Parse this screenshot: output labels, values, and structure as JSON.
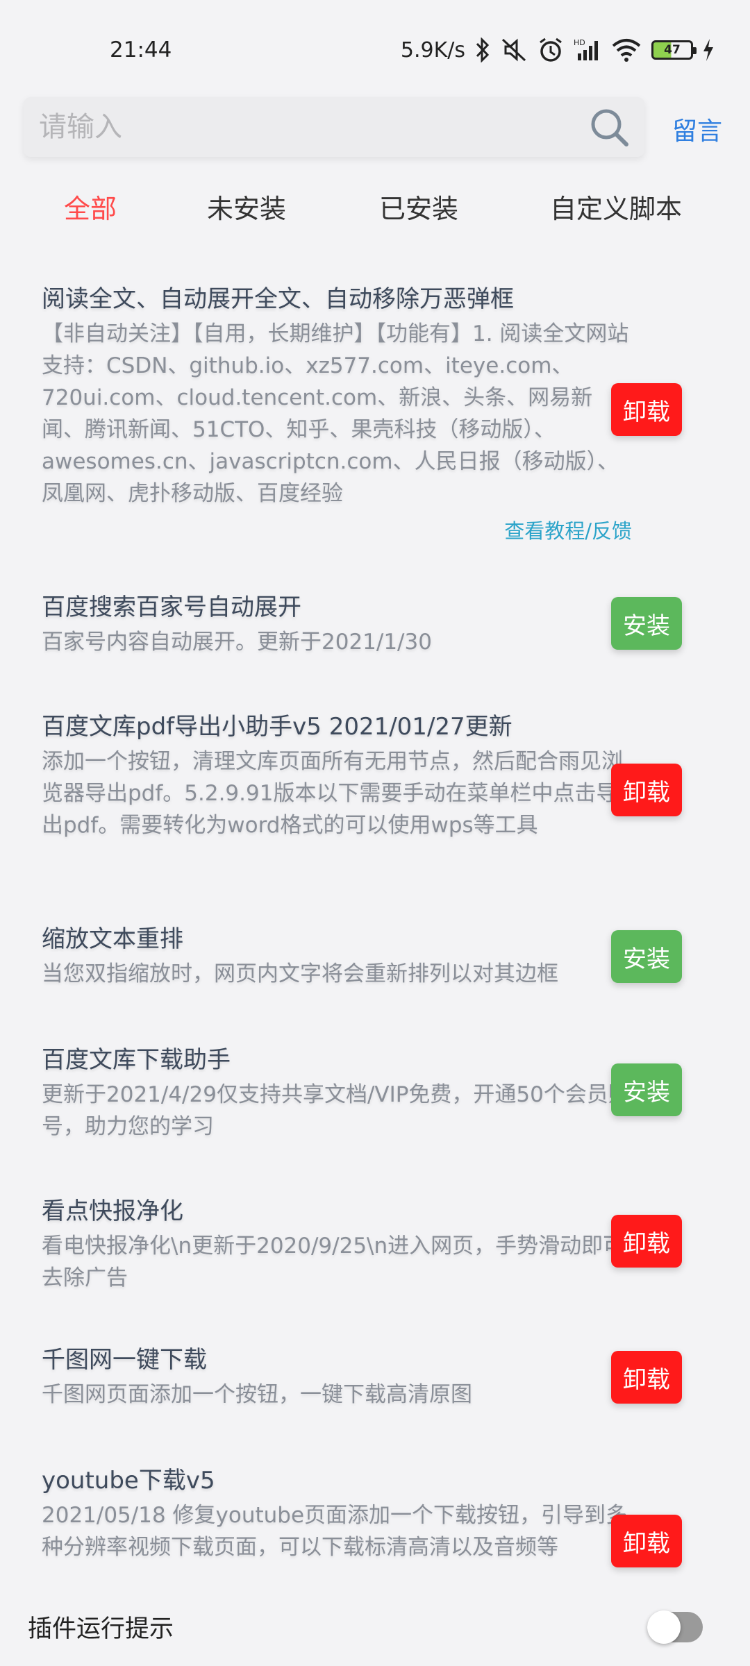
{
  "status_bar": {
    "time": "21:44",
    "net_speed": "5.9K/s",
    "battery_level": "47"
  },
  "search": {
    "placeholder": "请输入",
    "leave_message": "留言"
  },
  "tabs": [
    {
      "label": "全部",
      "active": true
    },
    {
      "label": "未安装",
      "active": false
    },
    {
      "label": "已安装",
      "active": false
    },
    {
      "label": "自定义脚本",
      "active": false
    }
  ],
  "items": [
    {
      "title": "阅读全文、自动展开全文、自动移除万恶弹框",
      "desc": "【非自动关注】【自用，长期维护】【功能有】1. 阅读全文网站支持：CSDN、github.io、xz577.com、iteye.com、720ui.com、cloud.tencent.com、新浪、头条、网易新闻、腾讯新闻、51CTO、知乎、果壳科技（移动版）、awesomes.cn、javascriptcn.com、人民日报（移动版）、凤凰网、虎扑移动版、百度经验",
      "link": "查看教程/反馈",
      "action": "卸载"
    },
    {
      "title": "百度搜索百家号自动展开",
      "desc": "百家号内容自动展开。更新于2021/1/30",
      "action": "安装"
    },
    {
      "title": "百度文库pdf导出小助手v5  2021/01/27更新",
      "desc": "添加一个按钮，清理文库页面所有无用节点，然后配合雨见浏览器导出pdf。5.2.9.91版本以下需要手动在菜单栏中点击导出pdf。需要转化为word格式的可以使用wps等工具",
      "action": "卸载"
    },
    {
      "title": "缩放文本重排",
      "desc": "当您双指缩放时，网页内文字将会重新排列以对其边框",
      "action": "安装"
    },
    {
      "title": "百度文库下载助手",
      "desc": "更新于2021/4/29仅支持共享文档/VIP免费，开通50个会员账号，助力您的学习",
      "action": "安装"
    },
    {
      "title": "看点快报净化",
      "desc": "看电快报净化\\n更新于2020/9/25\\n进入网页，手势滑动即可去除广告",
      "action": "卸载"
    },
    {
      "title": "千图网一键下载",
      "desc": "千图网页面添加一个按钮，一键下载高清原图",
      "action": "卸载"
    },
    {
      "title": "youtube下载v5",
      "desc": "2021/05/18 修复youtube页面添加一个下载按钮，引导到多种分辨率视频下载页面，可以下载标清高清以及音频等",
      "action": "卸载"
    }
  ],
  "bottom": {
    "label": "插件运行提示",
    "toggle_on": false
  },
  "colors": {
    "accent_red": "#ff1a1a",
    "install_green": "#5cb85c",
    "tab_active": "#ff4a4a",
    "link_blue": "#2f7fe0"
  }
}
